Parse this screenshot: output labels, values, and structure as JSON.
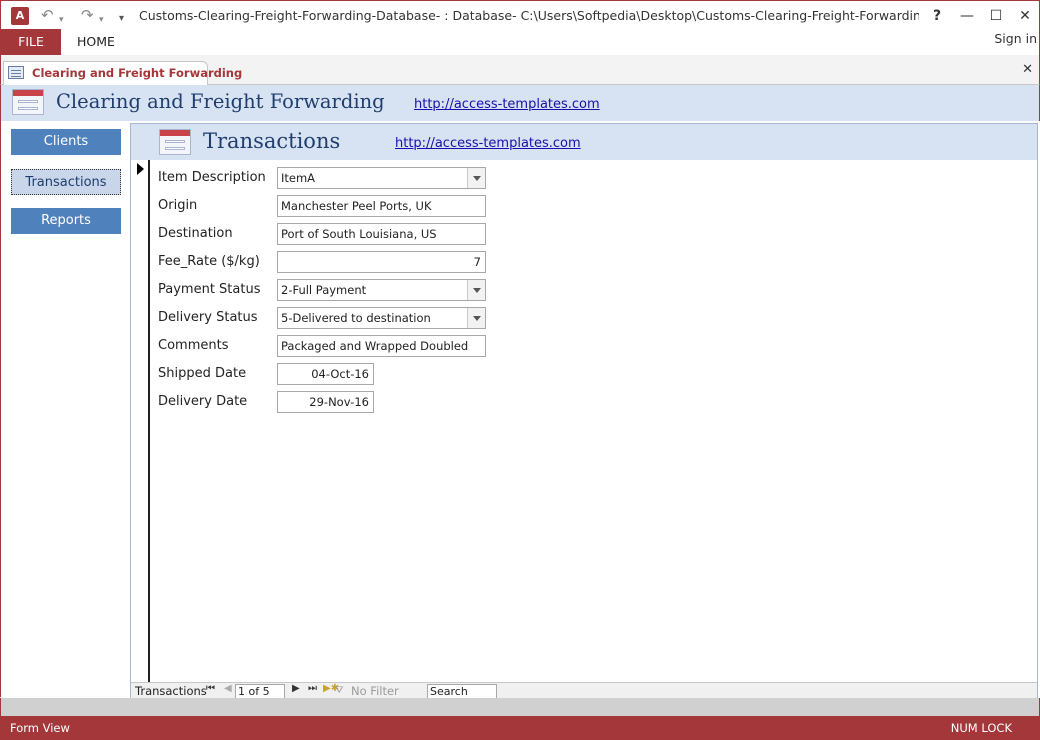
{
  "window": {
    "title": "Customs-Clearing-Freight-Forwarding-Database- : Database- C:\\Users\\Softpedia\\Desktop\\Customs-Clearing-Freight-Forwarding-Database-\\Cus...",
    "help": "?",
    "app_icon_text": "A"
  },
  "ribbon": {
    "file_label": "FILE",
    "home_label": "HOME",
    "sign_in": "Sign in"
  },
  "document_tab": {
    "label": "Clearing and Freight Forwarding"
  },
  "main_header": {
    "title": "Clearing and Freight Forwarding",
    "link": "http://access-templates.com"
  },
  "nav": {
    "clients": "Clients",
    "transactions": "Transactions",
    "reports": "Reports",
    "active": "transactions"
  },
  "subform": {
    "title": "Transactions",
    "link": "http://access-templates.com",
    "fields": {
      "item_description": {
        "label": "Item Description",
        "value": "ItemA"
      },
      "origin": {
        "label": "Origin",
        "value": "Manchester Peel Ports, UK"
      },
      "destination": {
        "label": "Destination",
        "value": "Port of South Louisiana, US"
      },
      "fee_rate": {
        "label": "Fee_Rate ($/kg)",
        "value": "7"
      },
      "payment_status": {
        "label": "Payment Status",
        "value": "2-Full Payment"
      },
      "delivery_status": {
        "label": "Delivery Status",
        "value": "5-Delivered to destination"
      },
      "comments": {
        "label": "Comments",
        "value": "Packaged and Wrapped Doubled"
      },
      "shipped_date": {
        "label": "Shipped Date",
        "value": "04-Oct-16"
      },
      "delivery_date": {
        "label": "Delivery Date",
        "value": "29-Nov-16"
      }
    },
    "navigator": {
      "label": "Transactions",
      "current": "1 of 5",
      "no_filter": "No Filter",
      "search": "Search"
    }
  },
  "status": {
    "view": "Form View",
    "num_lock": "NUM LOCK"
  },
  "colors": {
    "accent": "#a4373a",
    "header_band": "#d7e3f3",
    "nav_button": "#4f81bd",
    "link": "#1a0dab"
  }
}
